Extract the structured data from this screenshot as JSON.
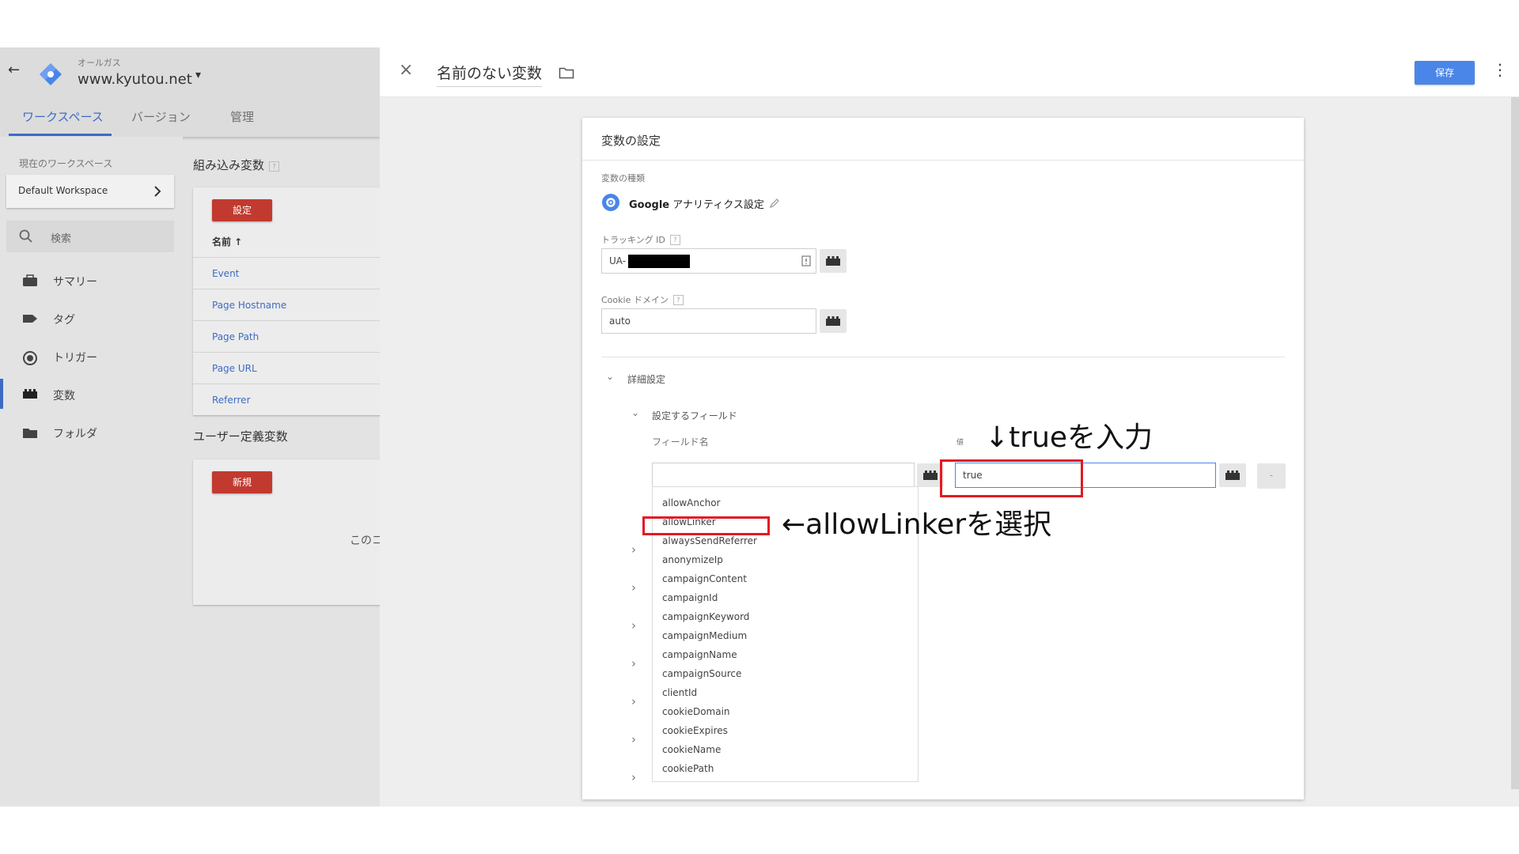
{
  "header": {
    "account_name": "オールガス",
    "container_name": "www.kyutou.net",
    "back_icon": "←",
    "dropdown_icon": "▾"
  },
  "tabs": [
    {
      "label": "ワークスペース",
      "active": true
    },
    {
      "label": "バージョン",
      "active": false
    },
    {
      "label": "管理",
      "active": false
    }
  ],
  "sidebar": {
    "workspace_caption": "現在のワークスペース",
    "workspace_name": "Default Workspace",
    "search_placeholder": "検索",
    "items": [
      {
        "label": "サマリー",
        "icon": "briefcase-icon"
      },
      {
        "label": "タグ",
        "icon": "tag-icon"
      },
      {
        "label": "トリガー",
        "icon": "trigger-icon"
      },
      {
        "label": "変数",
        "icon": "variable-brick-icon",
        "active": true
      },
      {
        "label": "フォルダ",
        "icon": "folder-icon"
      }
    ]
  },
  "builtin_vars": {
    "heading": "組み込み変数",
    "help": "?",
    "config_button": "設定",
    "name_column": "名前 ↑",
    "rows": [
      "Event",
      "Page Hostname",
      "Page Path",
      "Page URL",
      "Referrer"
    ]
  },
  "user_vars": {
    "heading": "ユーザー定義変数",
    "new_button": "新規",
    "partial_text": "このコ"
  },
  "editor": {
    "title": "名前のない変数",
    "save_label": "保存",
    "close_icon": "×",
    "more_icon": "⋮"
  },
  "settings": {
    "card_title": "変数の設定",
    "type_label": "変数の種類",
    "type_value_bold": "Google",
    "type_value_rest": " アナリティクス設定",
    "tracking_id_label": "トラッキング ID",
    "tracking_id_value": "UA-",
    "cookie_domain_label": "Cookie ドメイン",
    "cookie_domain_value": "auto",
    "advanced_label": "詳細設定",
    "fields_label": "設定するフィールド",
    "field_name_label": "フィールド名",
    "value_label": "値",
    "value_input": "true",
    "remove_label": "-",
    "help": "?"
  },
  "dropdown_options": [
    "allowAnchor",
    "allowLinker",
    "alwaysSendReferrer",
    "anonymizeIp",
    "campaignContent",
    "campaignId",
    "campaignKeyword",
    "campaignMedium",
    "campaignName",
    "campaignSource",
    "clientId",
    "cookieDomain",
    "cookieExpires",
    "cookieName",
    "cookiePath"
  ],
  "annotations": {
    "true_hint": "↓trueを入力",
    "linker_hint": "←allowLinkerを選択"
  },
  "colors": {
    "accent_blue": "#3e6bc2",
    "save_blue": "#4a86e8",
    "red_button": "#c23a2f",
    "annotation_red": "#e01a22"
  }
}
